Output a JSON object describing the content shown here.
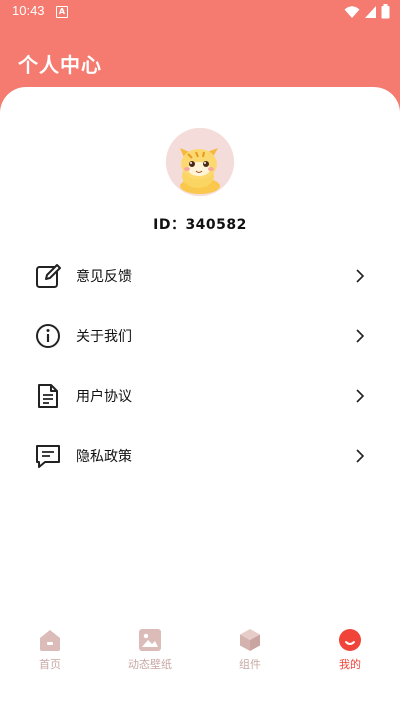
{
  "status_bar": {
    "time": "10:43",
    "badge": "A"
  },
  "header": {
    "title": "个人中心"
  },
  "profile": {
    "id_text": "ID：340582"
  },
  "menu": [
    {
      "label": "意见反馈",
      "icon": "edit-icon"
    },
    {
      "label": "关于我们",
      "icon": "info-icon"
    },
    {
      "label": "用户协议",
      "icon": "document-icon"
    },
    {
      "label": "隐私政策",
      "icon": "message-icon"
    }
  ],
  "nav": [
    {
      "label": "首页",
      "icon": "home-icon",
      "active": false
    },
    {
      "label": "动态壁纸",
      "icon": "image-icon",
      "active": false
    },
    {
      "label": "组件",
      "icon": "cube-icon",
      "active": false
    },
    {
      "label": "我的",
      "icon": "smile-icon",
      "active": true
    }
  ],
  "colors": {
    "accent": "#f57a6f",
    "nav_active": "#f0443a",
    "nav_inactive": "#d9b9b6"
  }
}
